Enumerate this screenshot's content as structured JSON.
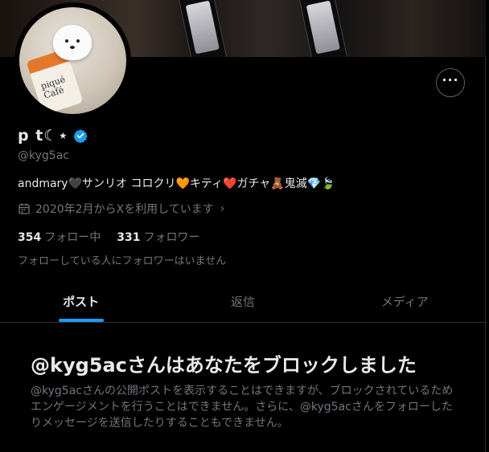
{
  "profile": {
    "display_name": "p t☾⋆",
    "handle": "@kyg5ac",
    "bio": "andmary🖤サンリオ コロクリ🧡キティ❤️ガチャ🧸鬼滅💎🍃",
    "joined": "2020年2月からXを利用しています",
    "avatar_text": "piqué Café"
  },
  "stats": {
    "following_count": "354",
    "following_label": "フォロー中",
    "followers_count": "331",
    "followers_label": "フォロワー"
  },
  "mutual_note": "フォローしている人にフォロワーはいません",
  "tabs": [
    {
      "label": "ポスト",
      "active": true
    },
    {
      "label": "返信",
      "active": false
    },
    {
      "label": "メディア",
      "active": false
    }
  ],
  "block": {
    "title": "@kyg5acさんはあなたをブロックしました",
    "description": "@kyg5acさんの公開ポストを表示することはできますが、ブロックされているためエンゲージメントを行うことはできません。さらに、@kyg5acさんをフォローしたりメッセージを送信したりすることもできません。"
  },
  "icons": {
    "more": "more-icon",
    "verified": "verified-badge-icon",
    "calendar": "calendar-icon",
    "chevron": "chevron-right-icon"
  },
  "colors": {
    "accent": "#1d9bf0",
    "background": "#000000",
    "text_primary": "#e7e9ea",
    "text_secondary": "#71767b"
  }
}
